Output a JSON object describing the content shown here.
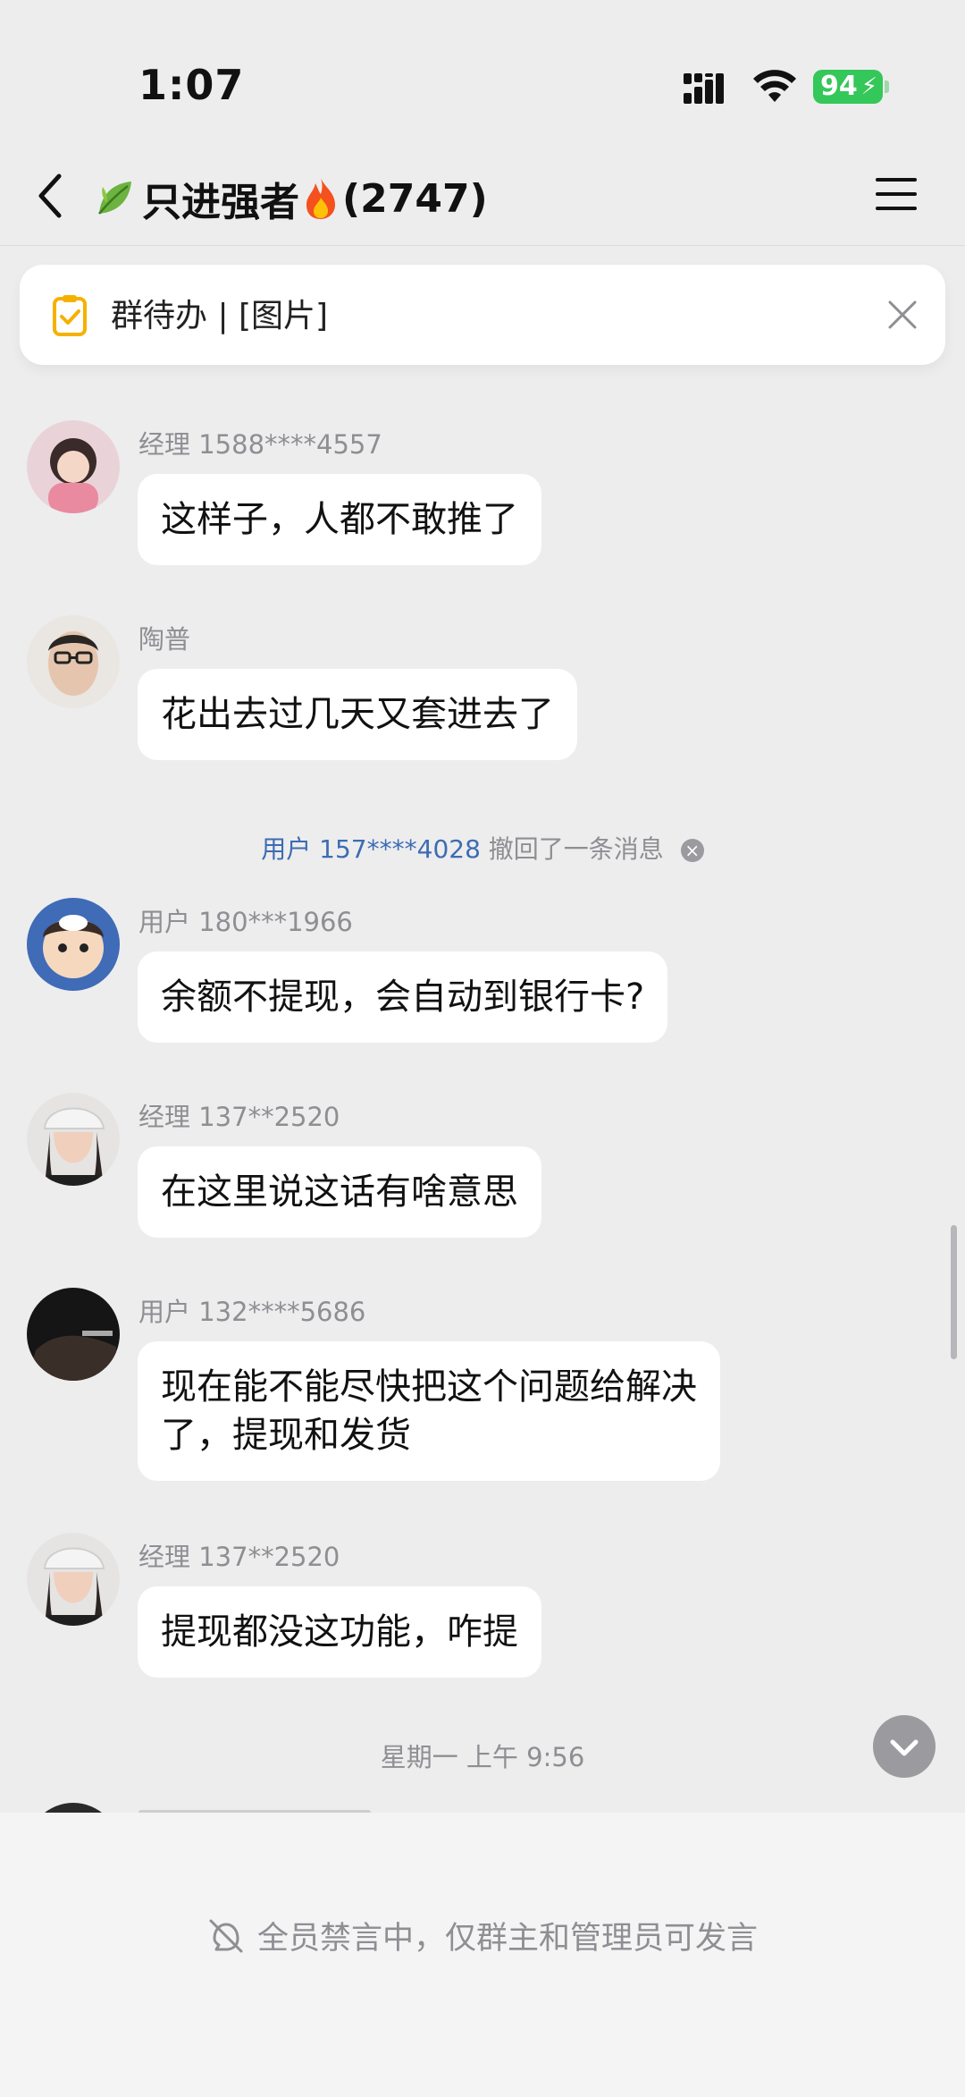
{
  "status_bar": {
    "time": "1:07",
    "battery": "94",
    "battery_color": "#34c759"
  },
  "nav": {
    "title_text": "只进强者",
    "member_count": "(2747)",
    "icons": [
      "back-icon",
      "leaf-icon",
      "fire-icon",
      "menu-icon"
    ]
  },
  "todo_banner": {
    "text": "群待办 | [图片]"
  },
  "messages": [
    {
      "sender": "经理 1588****4557",
      "text": "这样子，人都不敢推了"
    },
    {
      "sender": "陶普",
      "text": "花出去过几天又套进去了"
    },
    {
      "sender": "用户 180***1966",
      "text": "余额不提现，会自动到银行卡?"
    },
    {
      "sender": "经理 137**2520",
      "text": "在这里说这话有啥意思"
    },
    {
      "sender": "用户 132****5686",
      "line1": "现在能不能尽快把这个问题给解决",
      "line2": "了，提现和发货"
    },
    {
      "sender": "经理 137**2520",
      "text": "提现都没这功能，咋提"
    }
  ],
  "recall_notice": {
    "user": "用户 157****4028",
    "text": "撤回了一条消息"
  },
  "timestamp": "星期一 上午 9:56",
  "mute_notice": "全员禁言中，仅群主和管理员可发言",
  "colors": {
    "background": "#ededee",
    "bubble": "#ffffff",
    "link": "#3d6cb3",
    "muted_text": "#8e8e93"
  }
}
